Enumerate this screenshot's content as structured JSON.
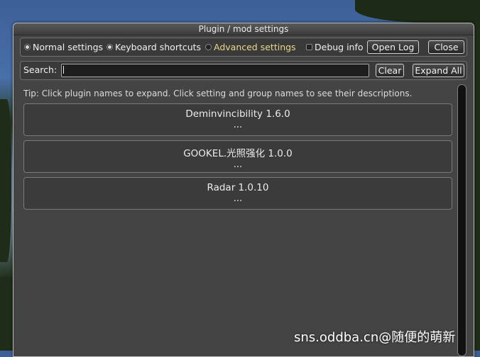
{
  "window": {
    "title": "Plugin / mod settings"
  },
  "toolbar": {
    "normal_settings": "Normal settings",
    "keyboard_shortcuts": "Keyboard shortcuts",
    "advanced_settings": "Advanced settings",
    "debug_info": "Debug info",
    "open_log": "Open Log",
    "close": "Close",
    "selected_mode": "Keyboard shortcuts"
  },
  "search": {
    "label": "Search:",
    "value": "",
    "clear": "Clear",
    "expand_all": "Expand All"
  },
  "tip": "Tip: Click plugin names to expand. Click setting and group names to see their descriptions.",
  "plugins": [
    {
      "name": "Deminvincibility 1.6.0",
      "details": "..."
    },
    {
      "name": "GOOKEL.光照强化 1.0.0",
      "details": "..."
    },
    {
      "name": "Radar 1.0.10",
      "details": "..."
    }
  ],
  "watermark": "sns.oddba.cn@随便的萌新",
  "colors": {
    "advanced_label": "#e9d88a",
    "panel": "#444444"
  }
}
